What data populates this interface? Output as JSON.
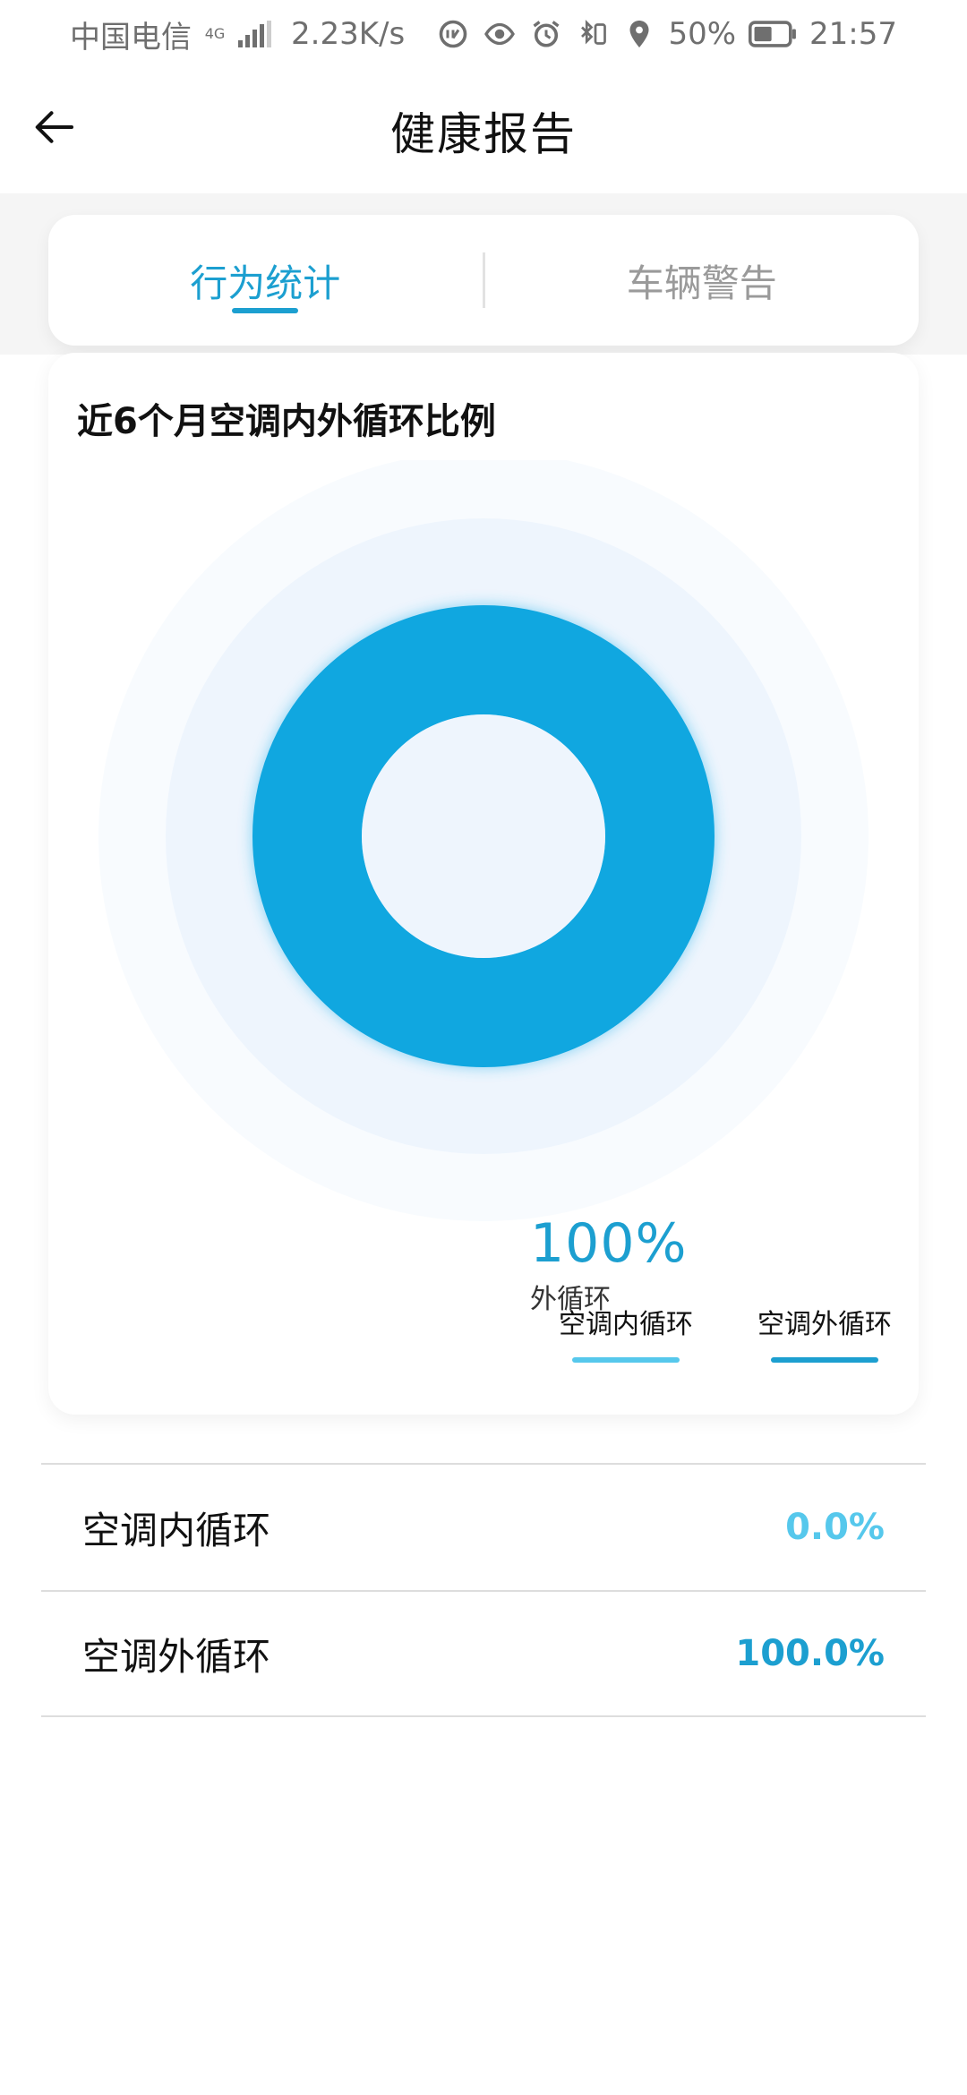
{
  "status_bar": {
    "carrier": "中国电信",
    "network": "4G",
    "speed": "2.23K/s",
    "battery": "50%",
    "time": "21:57",
    "icons": [
      "nfc-icon",
      "eye-icon",
      "alarm-icon",
      "bluetooth-vibrate-icon",
      "location-icon",
      "battery-icon"
    ]
  },
  "header": {
    "title": "健康报告",
    "back_icon": "arrow-left-icon"
  },
  "tabs": [
    {
      "label": "行为统计",
      "active": true
    },
    {
      "label": "车辆警告",
      "active": false
    }
  ],
  "colors": {
    "accent": "#1c9fd0",
    "inner_series": "#56c8ec",
    "outer_series": "#10a7e0",
    "donut_bg": "#eef5fd"
  },
  "chart": {
    "title": "近6个月空调内外循环比例",
    "center_value": "100%",
    "center_label": "外循环",
    "legend": [
      {
        "label": "空调内循环",
        "color": "#56c8ec"
      },
      {
        "label": "空调外循环",
        "color": "#1c9fd0"
      }
    ]
  },
  "chart_data": {
    "type": "pie",
    "title": "近6个月空调内外循环比例",
    "categories": [
      "空调内循环",
      "空调外循环"
    ],
    "values": [
      0.0,
      100.0
    ],
    "legend_position": "bottom-right"
  },
  "rows": [
    {
      "label": "空调内循环",
      "value": "0.0%",
      "color": "#56c8ec"
    },
    {
      "label": "空调外循环",
      "value": "100.0%",
      "color": "#1c9fd0"
    }
  ]
}
